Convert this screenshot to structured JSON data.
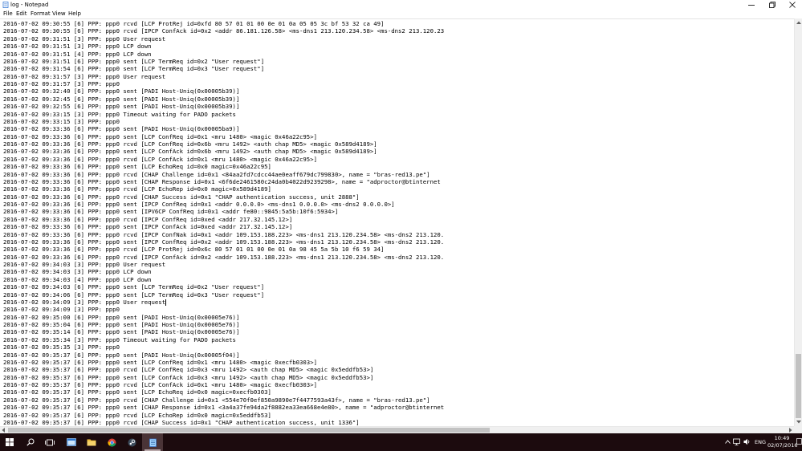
{
  "window": {
    "title": "log - Notepad"
  },
  "menu": [
    "File",
    "Edit",
    "Format",
    "View",
    "Help"
  ],
  "log_lines": [
    "2016-07-02 09:30:55 [6] PPP: ppp0 rcvd [LCP ProtRej id=0xfd 80 57 01 01 00 0e 01 0a 05 05 3c bf 53 32 ca 49]",
    "2016-07-02 09:30:55 [6] PPP: ppp0 rcvd [IPCP ConfAck id=0x2 <addr 86.181.126.58> <ms-dns1 213.120.234.58> <ms-dns2 213.120.23",
    "2016-07-02 09:31:51 [3] PPP: ppp0 User request",
    "2016-07-02 09:31:51 [3] PPP: ppp0 LCP down",
    "2016-07-02 09:31:51 [4] PPP: ppp0 LCP down",
    "2016-07-02 09:31:51 [6] PPP: ppp0 sent [LCP TermReq id=0x2 \"User request\"]",
    "2016-07-02 09:31:54 [6] PPP: ppp0 sent [LCP TermReq id=0x3 \"User request\"]",
    "2016-07-02 09:31:57 [3] PPP: ppp0 User request",
    "2016-07-02 09:31:57 [3] PPP: ppp0",
    "2016-07-02 09:32:40 [6] PPP: ppp0 sent [PADI Host-Uniq(0x00005b39)]",
    "2016-07-02 09:32:45 [6] PPP: ppp0 sent [PADI Host-Uniq(0x00005b39)]",
    "2016-07-02 09:32:55 [6] PPP: ppp0 sent [PADI Host-Uniq(0x00005b39)]",
    "2016-07-02 09:33:15 [3] PPP: ppp0 Timeout waiting for PADO packets",
    "2016-07-02 09:33:15 [3] PPP: ppp0",
    "2016-07-02 09:33:36 [6] PPP: ppp0 sent [PADI Host-Uniq(0x00005ba9)]",
    "2016-07-02 09:33:36 [6] PPP: ppp0 sent [LCP ConfReq id=0x1 <mru 1480> <magic 0x46a22c95>]",
    "2016-07-02 09:33:36 [6] PPP: ppp0 rcvd [LCP ConfReq id=0x6b <mru 1492> <auth chap MD5> <magic 0x589d4189>]",
    "2016-07-02 09:33:36 [6] PPP: ppp0 sent [LCP ConfAck id=0x6b <mru 1492> <auth chap MD5> <magic 0x589d4189>]",
    "2016-07-02 09:33:36 [6] PPP: ppp0 rcvd [LCP ConfAck id=0x1 <mru 1480> <magic 0x46a22c95>]",
    "2016-07-02 09:33:36 [6] PPP: ppp0 sent [LCP EchoReq id=0x0 magic=0x46a22c95]",
    "2016-07-02 09:33:36 [6] PPP: ppp0 rcvd [CHAP Challenge id=0x1 <84aa2fd7cdcc44ae0eaff679dc799830>, name = \"bras-red13.pe\"]",
    "2016-07-02 09:33:36 [6] PPP: ppp0 sent [CHAP Response id=0x1 <6f6de2461580c24da0b4022d9239298>, name = \"adproctor@btinternet",
    "2016-07-02 09:33:36 [6] PPP: ppp0 rcvd [LCP EchoRep id=0x0 magic=0x589d4189]",
    "2016-07-02 09:33:36 [6] PPP: ppp0 rcvd [CHAP Success id=0x1 \"CHAP authentication success, unit 2888\"]",
    "2016-07-02 09:33:36 [6] PPP: ppp0 sent [IPCP ConfReq id=0x1 <addr 0.0.0.0> <ms-dns1 0.0.0.0> <ms-dns2 0.0.0.0>]",
    "2016-07-02 09:33:36 [6] PPP: ppp0 sent [IPV6CP ConfReq id=0x1 <addr fe80::9845:5a5b:10f6:5934>]",
    "2016-07-02 09:33:36 [6] PPP: ppp0 rcvd [IPCP ConfReq id=0xed <addr 217.32.145.12>]",
    "2016-07-02 09:33:36 [6] PPP: ppp0 sent [IPCP ConfAck id=0xed <addr 217.32.145.12>]",
    "2016-07-02 09:33:36 [6] PPP: ppp0 rcvd [IPCP ConfNak id=0x1 <addr 109.153.188.223> <ms-dns1 213.120.234.58> <ms-dns2 213.120.",
    "2016-07-02 09:33:36 [6] PPP: ppp0 sent [IPCP ConfReq id=0x2 <addr 109.153.188.223> <ms-dns1 213.120.234.58> <ms-dns2 213.120.",
    "2016-07-02 09:33:36 [6] PPP: ppp0 rcvd [LCP ProtRej id=0x6c 80 57 01 01 00 0e 01 0a 98 45 5a 5b 10 f6 59 34]",
    "2016-07-02 09:33:36 [6] PPP: ppp0 rcvd [IPCP ConfAck id=0x2 <addr 109.153.188.223> <ms-dns1 213.120.234.58> <ms-dns2 213.120.",
    "2016-07-02 09:34:03 [3] PPP: ppp0 User request",
    "2016-07-02 09:34:03 [3] PPP: ppp0 LCP down",
    "2016-07-02 09:34:03 [4] PPP: ppp0 LCP down",
    "2016-07-02 09:34:03 [6] PPP: ppp0 sent [LCP TermReq id=0x2 \"User request\"]",
    "2016-07-02 09:34:06 [6] PPP: ppp0 sent [LCP TermReq id=0x3 \"User request\"]",
    "2016-07-02 09:34:09 [3] PPP: ppp0 User request",
    "2016-07-02 09:34:09 [3] PPP: ppp0",
    "2016-07-02 09:35:00 [6] PPP: ppp0 sent [PADI Host-Uniq(0x00005e76)]",
    "2016-07-02 09:35:04 [6] PPP: ppp0 sent [PADI Host-Uniq(0x00005e76)]",
    "2016-07-02 09:35:14 [6] PPP: ppp0 sent [PADI Host-Uniq(0x00005e76)]",
    "2016-07-02 09:35:34 [3] PPP: ppp0 Timeout waiting for PADO packets",
    "2016-07-02 09:35:35 [3] PPP: ppp0",
    "2016-07-02 09:35:37 [6] PPP: ppp0 sent [PADI Host-Uniq(0x00005f04)]",
    "2016-07-02 09:35:37 [6] PPP: ppp0 sent [LCP ConfReq id=0x1 <mru 1480> <magic 0xecfb0303>]",
    "2016-07-02 09:35:37 [6] PPP: ppp0 rcvd [LCP ConfReq id=0x3 <mru 1492> <auth chap MD5> <magic 0x5eddfb53>]",
    "2016-07-02 09:35:37 [6] PPP: ppp0 sent [LCP ConfAck id=0x3 <mru 1492> <auth chap MD5> <magic 0x5eddfb53>]",
    "2016-07-02 09:35:37 [6] PPP: ppp0 rcvd [LCP ConfAck id=0x1 <mru 1480> <magic 0xecfb0303>]",
    "2016-07-02 09:35:37 [6] PPP: ppp0 sent [LCP EchoReq id=0x0 magic=0xecfb0303]",
    "2016-07-02 09:35:37 [6] PPP: ppp0 rcvd [CHAP Challenge id=0x1 <554e70f0ef850a9890e7f4477593a43f>, name = \"bras-red13.pe\"]",
    "2016-07-02 09:35:37 [6] PPP: ppp0 sent [CHAP Response id=0x1 <3a4a37fe94da2f8882ea33ea668e4e80>, name = \"adproctor@btinternet",
    "2016-07-02 09:35:37 [6] PPP: ppp0 rcvd [LCP EchoRep id=0x0 magic=0x5eddfb53]",
    "2016-07-02 09:35:37 [6] PPP: ppp0 rcvd [CHAP Success id=0x1 \"CHAP authentication success, unit 1336\"]"
  ],
  "caret_line": 37,
  "taskbar": {
    "language": "ENG",
    "time": "10:49",
    "date": "02/07/2016"
  },
  "colors": {
    "taskbar_bg": "#1c0b0e",
    "scroll_thumb": "#c2c2c2"
  }
}
